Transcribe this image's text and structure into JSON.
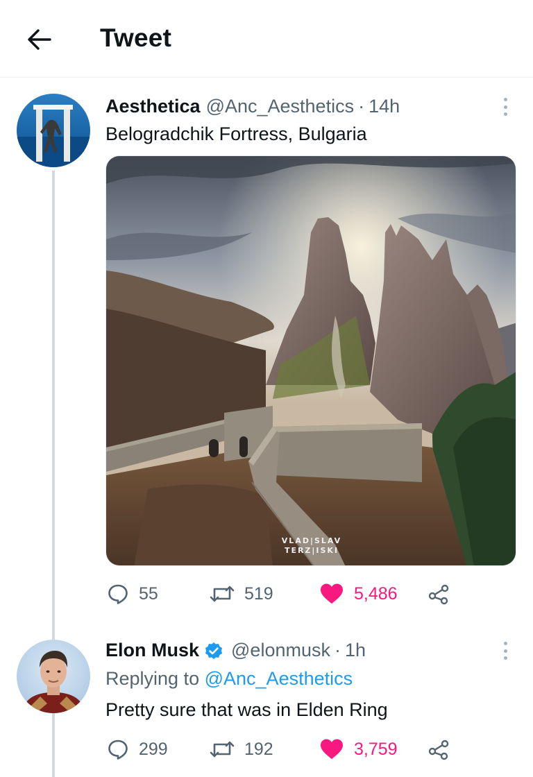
{
  "header": {
    "title": "Tweet"
  },
  "tweets": [
    {
      "display_name": "Aesthetica",
      "handle": "@Anc_Aesthetics",
      "separator": "·",
      "time": "14h",
      "text": "Belogradchik Fortress, Bulgaria",
      "media_watermark_line1": "VLAD|SLAV",
      "media_watermark_line2": "TERZ|ISKI",
      "replies": "55",
      "retweets": "519",
      "likes": "5,486"
    },
    {
      "display_name": "Elon Musk",
      "handle": "@elonmusk",
      "separator": "·",
      "time": "1h",
      "replying_prefix": "Replying to",
      "replying_handle": "@Anc_Aesthetics",
      "text": "Pretty sure that was in Elden Ring",
      "replies": "299",
      "retweets": "192",
      "likes": "3,759"
    }
  ],
  "colors": {
    "accent": "#1d9bf0",
    "like": "#f91880",
    "muted": "#536471",
    "verified": "#1d9bf0"
  },
  "icons": {
    "back": "arrow-left-icon",
    "more": "more-vertical-icon",
    "reply": "reply-bubble-icon",
    "retweet": "retweet-icon",
    "like": "heart-filled-icon",
    "share": "share-icon",
    "verified": "verified-badge-icon"
  }
}
